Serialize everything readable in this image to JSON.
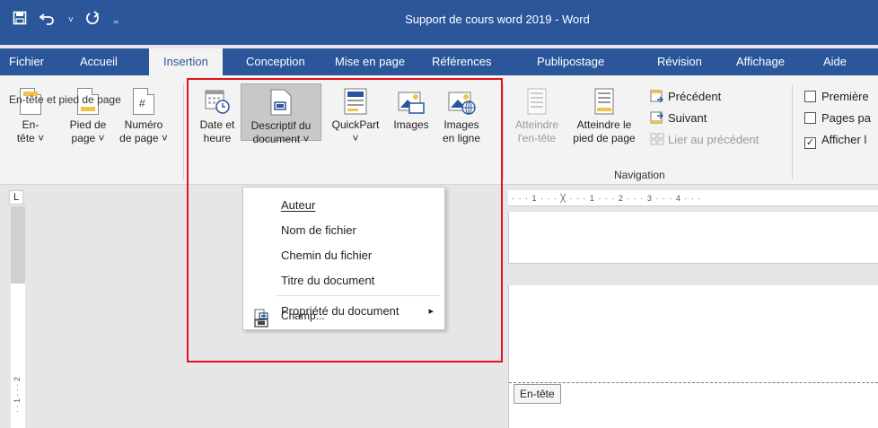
{
  "window": {
    "title": "Support de cours word 2019  -  Word",
    "save_icon": "save-icon",
    "undo_icon": "undo-icon",
    "redo_icon": "redo-icon"
  },
  "tabs": [
    "Fichier",
    "Accueil",
    "Insertion",
    "Conception",
    "Mise en page",
    "Références",
    "Publipostage",
    "Révision",
    "Affichage",
    "Aide"
  ],
  "active_tab": "Insertion",
  "ribbon": {
    "header_footer_group": {
      "name": "En-tête et pied de page",
      "header_line1": "En-",
      "header_line2": "tête ˅",
      "footer_line1": "Pied de",
      "footer_line2": "page ˅",
      "pagenum_line1": "Numéro",
      "pagenum_line2": "de page ˅"
    },
    "text_group": {
      "date_line1": "Date et",
      "date_line2": "heure",
      "docinfo_line1": "Descriptif du",
      "docinfo_line2": "document ˅",
      "quickpart_line1": "QuickPart",
      "quickpart_line2": "˅",
      "images": "Images",
      "online_line1": "Images",
      "online_line2": "en ligne"
    },
    "navigation_group": {
      "name": "Navigation",
      "goto_header_line1": "Atteindre",
      "goto_header_line2": "l'en-tête",
      "goto_footer_line1": "Atteindre le",
      "goto_footer_line2": "pied de page",
      "previous": "Précédent",
      "next": "Suivant",
      "link_previous": "Lier au précédent"
    },
    "options_group": {
      "first_page": "Première",
      "odd_even": "Pages pa",
      "show_text": "Afficher l"
    }
  },
  "dropdown": {
    "items": [
      "Auteur",
      "Nom de fichier",
      "Chemin du fichier",
      "Titre du document",
      "Propriété du document",
      "Champ..."
    ],
    "submenu_arrow": "▸"
  },
  "ruler": {
    "marks": "· · · 1 · · · ╳ · · · 1 · · · 2 · · · 3 · · · 4 · · ·",
    "corner": "L",
    "vertical_marks": "· · 1 · · · 2"
  },
  "document": {
    "header_tag": "En-tête"
  },
  "colors": {
    "accent": "#2b579a",
    "highlight_box": "#e0141e"
  }
}
